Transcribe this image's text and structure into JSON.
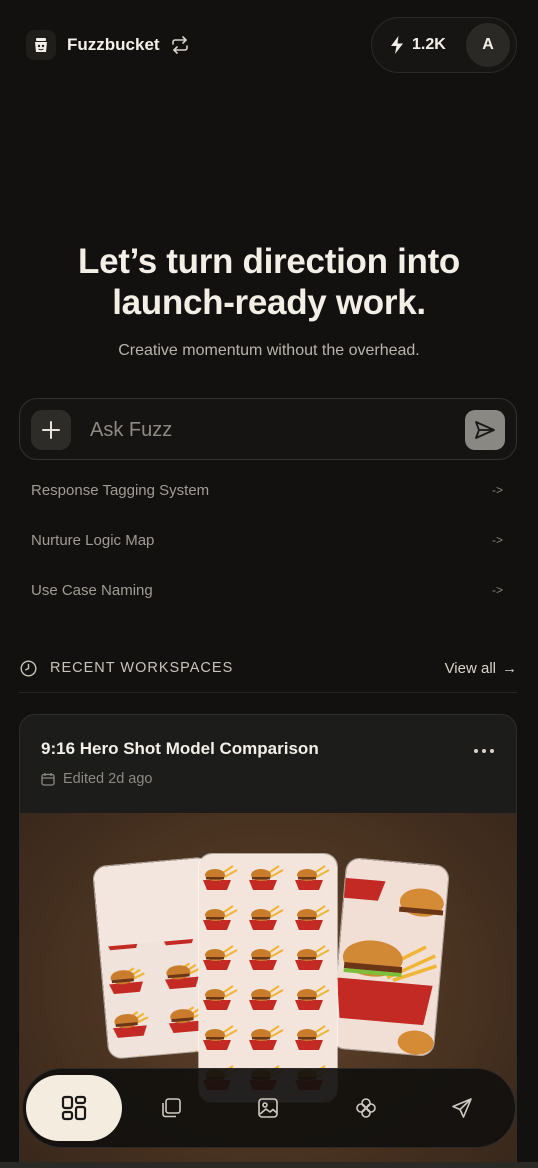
{
  "header": {
    "workspace_name": "Fuzzbucket",
    "credits": "1.2K",
    "avatar_initial": "A"
  },
  "hero": {
    "headline_line1": "Let’s turn direction into",
    "headline_line2": "launch-ready work.",
    "subheadline": "Creative momentum without the overhead."
  },
  "ask": {
    "placeholder": "Ask Fuzz"
  },
  "suggestions": [
    {
      "label": "Response Tagging System",
      "arrow": "->"
    },
    {
      "label": "Nurture Logic Map",
      "arrow": "->"
    },
    {
      "label": "Use Case Naming",
      "arrow": "->"
    }
  ],
  "recent": {
    "title": "RECENT WORKSPACES",
    "view_all": "View all",
    "view_all_arrow": "→"
  },
  "workspace_card": {
    "title": "9:16 Hero Shot Model Comparison",
    "edited": "Edited 2d ago"
  },
  "bottom_nav": {
    "items": [
      {
        "icon": "grid-icon",
        "active": true
      },
      {
        "icon": "copy-icon",
        "active": false
      },
      {
        "icon": "image-icon",
        "active": false
      },
      {
        "icon": "clover-icon",
        "active": false
      },
      {
        "icon": "send-icon",
        "active": false
      }
    ]
  },
  "colors": {
    "background": "#12110f",
    "text_primary": "#f3efe8",
    "text_muted": "#a19c94",
    "nav_active": "#f4ecdf",
    "send_button": "#8a8883"
  }
}
